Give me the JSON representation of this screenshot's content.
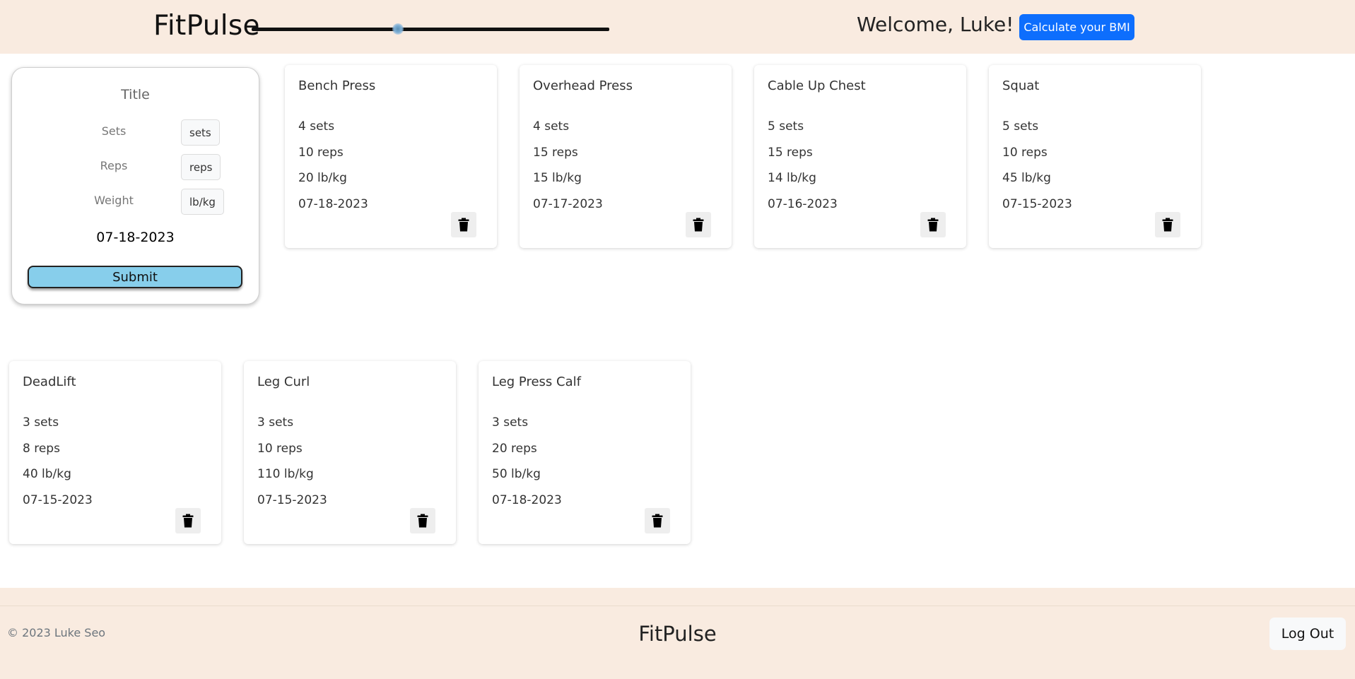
{
  "header": {
    "brand": "FitPulse",
    "slider_level": 0.41,
    "welcome": "Welcome, Luke!",
    "bmi_button": "Calculate your BMI"
  },
  "form": {
    "title": "Title",
    "sets_label": "Sets",
    "sets_value": "sets",
    "reps_label": "Reps",
    "reps_value": "reps",
    "weight_label": "Weight",
    "weight_value": "lb/kg",
    "date": "07-18-2023",
    "submit": "Submit"
  },
  "workouts": [
    {
      "title": "Bench Press",
      "sets": "4 sets",
      "reps": "10 reps",
      "weight": "20 lb/kg",
      "date": "07-18-2023"
    },
    {
      "title": "Overhead Press",
      "sets": "4 sets",
      "reps": "15 reps",
      "weight": "15 lb/kg",
      "date": "07-17-2023"
    },
    {
      "title": "Cable Up Chest",
      "sets": "5 sets",
      "reps": "15 reps",
      "weight": "14 lb/kg",
      "date": "07-16-2023"
    },
    {
      "title": "Squat",
      "sets": "5 sets",
      "reps": "10 reps",
      "weight": "45 lb/kg",
      "date": "07-15-2023"
    },
    {
      "title": "DeadLift",
      "sets": "3 sets",
      "reps": "8 reps",
      "weight": "40 lb/kg",
      "date": "07-15-2023"
    },
    {
      "title": "Leg Curl",
      "sets": "3 sets",
      "reps": "10 reps",
      "weight": "110 lb/kg",
      "date": "07-15-2023"
    },
    {
      "title": "Leg Press Calf",
      "sets": "3 sets",
      "reps": "20 reps",
      "weight": "50 lb/kg",
      "date": "07-18-2023"
    }
  ],
  "delete_icon": "trash-icon",
  "footer": {
    "copyright": "© 2023 Luke Seo",
    "brand": "FitPulse",
    "logout": "Log Out"
  },
  "colors": {
    "header_bg": "#f9ebe0",
    "bmi_button": "#0d6efd",
    "submit_button": "#87ceeb"
  }
}
